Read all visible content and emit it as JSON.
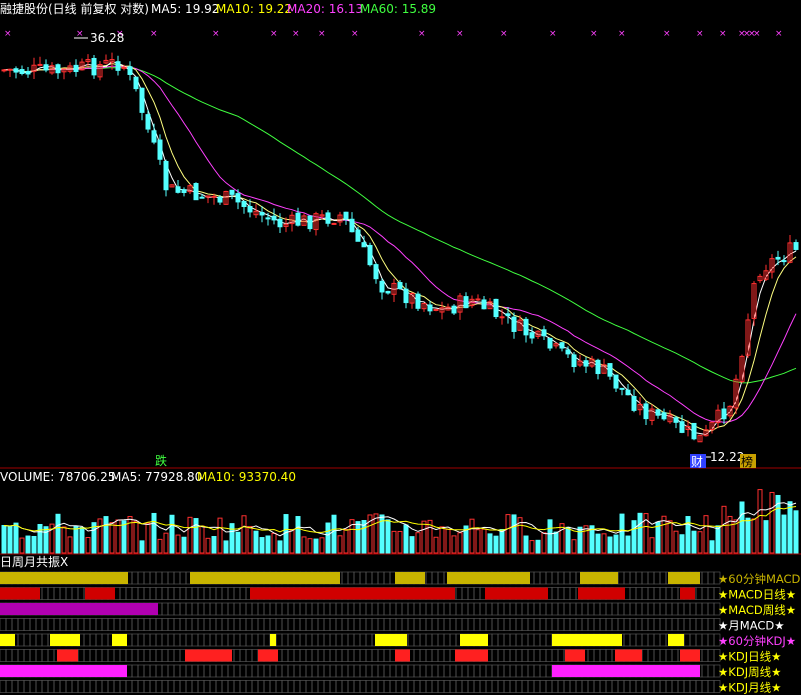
{
  "header": {
    "stock_name": "融捷股份(日线 前复权 对数)",
    "ma5": "MA5: 19.92",
    "ma10": "MA10: 19.22",
    "ma20": "MA20: 16.13",
    "ma60": "MA60: 15.89"
  },
  "price_panel": {
    "high_label": "36.28",
    "low_label": "12.22",
    "tag_die": "跌",
    "tag_cai": "财",
    "tag_bang": "榜"
  },
  "volume_panel": {
    "title": "VOLUME: 78706.25",
    "ma5": "MA5: 77928.80",
    "ma10": "MA10: 93370.40"
  },
  "resonance_panel": {
    "title": "日周月共振X",
    "rows": [
      {
        "label": "★60分钟MACD",
        "color": "#c8b400"
      },
      {
        "label": "★MACD日线★",
        "color": "#d00000"
      },
      {
        "label": "★MACD周线★",
        "color": "#b000b0"
      },
      {
        "label": "★月MACD★",
        "color": "#ffffff"
      },
      {
        "label": "★60分钟KDJ★",
        "color": "#ffff00"
      },
      {
        "label": "★KDJ日线★",
        "color": "#ff2020"
      },
      {
        "label": "★KDJ周线★",
        "color": "#ff20ff"
      },
      {
        "label": "★KDJ月线★",
        "color": "#ff20ff"
      }
    ]
  },
  "colors": {
    "up": "#ff3030",
    "down": "#54ffff",
    "ma5": "#ffffff",
    "ma10": "#ffff80",
    "ma20": "#ff40ff",
    "ma60": "#40ff40",
    "grid": "#800000"
  }
}
